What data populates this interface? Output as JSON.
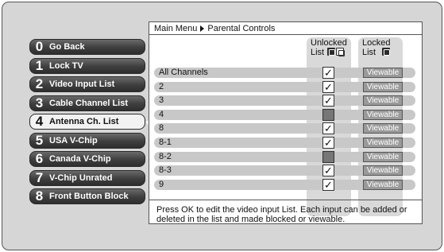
{
  "menu": {
    "items": [
      {
        "num": "0",
        "label": "Go Back"
      },
      {
        "num": "1",
        "label": "Lock TV"
      },
      {
        "num": "2",
        "label": "Video Input List"
      },
      {
        "num": "3",
        "label": "Cable Channel List"
      },
      {
        "num": "4",
        "label": "Antenna Ch. List"
      },
      {
        "num": "5",
        "label": "USA V-Chip"
      },
      {
        "num": "6",
        "label": "Canada V-Chip"
      },
      {
        "num": "7",
        "label": "V-Chip Unrated"
      },
      {
        "num": "8",
        "label": "Front Button Block"
      }
    ],
    "selected_index": 4
  },
  "breadcrumb": {
    "root": "Main Menu",
    "current": "Parental Controls"
  },
  "columns": {
    "unlocked_line1": "Unlocked",
    "unlocked_line2": "List",
    "locked_line1": "Locked",
    "locked_line2": "List"
  },
  "rows": [
    {
      "name": "All Channels",
      "checked": true,
      "status": "Viewable"
    },
    {
      "name": "2",
      "checked": true,
      "status": "Viewable"
    },
    {
      "name": "3",
      "checked": true,
      "status": "Viewable"
    },
    {
      "name": "4",
      "checked": false,
      "status": "Viewable"
    },
    {
      "name": "8",
      "checked": true,
      "status": "Viewable"
    },
    {
      "name": "8-1",
      "checked": true,
      "status": "Viewable"
    },
    {
      "name": "8-2",
      "checked": false,
      "status": "Viewable"
    },
    {
      "name": "8-3",
      "checked": true,
      "status": "Viewable"
    },
    {
      "name": "9",
      "checked": true,
      "status": "Viewable"
    }
  ],
  "help": {
    "text": "Press OK to edit the video input List. Each input can be added or deleted in the list and made blocked or viewable."
  },
  "icons": {
    "check": "checkmark-icon",
    "lock": "lock-icon",
    "unlock": "unlock-icon"
  }
}
